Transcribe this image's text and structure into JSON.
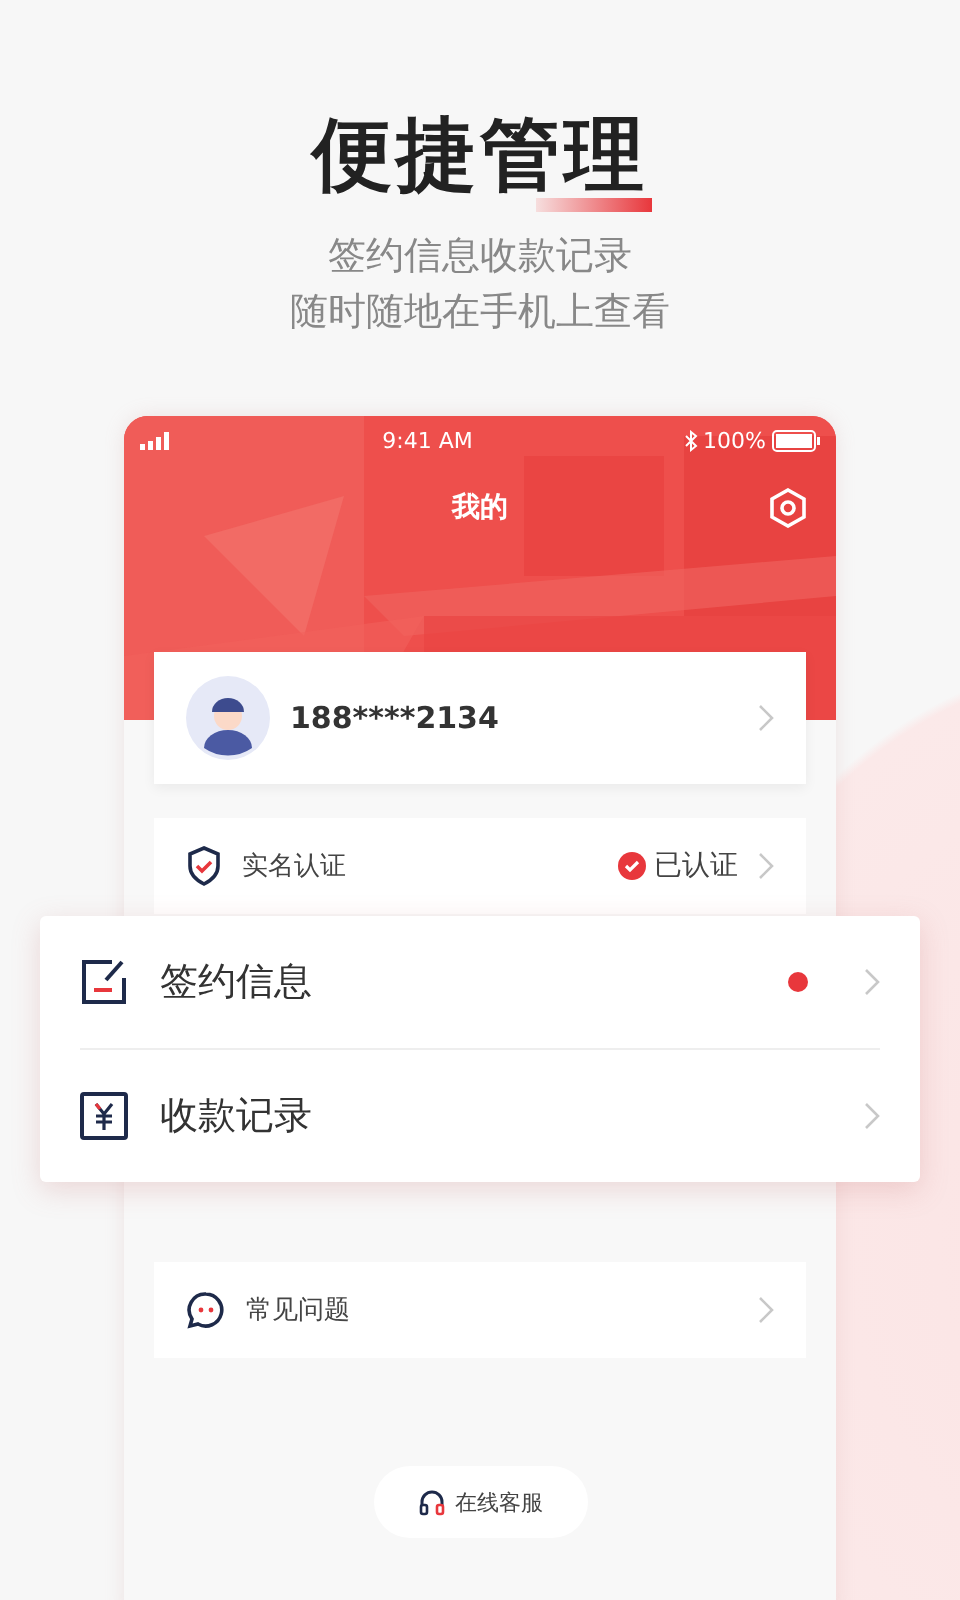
{
  "headline": "便捷管理",
  "subtitle": [
    "签约信息收款记录",
    "随时随地在手机上查看"
  ],
  "status_bar": {
    "time": "9:41 AM",
    "battery": "100%"
  },
  "page_title": "我的",
  "profile": {
    "phone": "188****2134"
  },
  "verify_row": {
    "label": "实名认证",
    "status": "已认证",
    "verified": true
  },
  "menu": [
    {
      "kind": "contract",
      "label": "签约信息",
      "unread": true
    },
    {
      "kind": "payment",
      "label": "收款记录",
      "unread": false
    }
  ],
  "faq_row": {
    "label": "常见问题"
  },
  "service_button": {
    "label": "在线客服"
  }
}
